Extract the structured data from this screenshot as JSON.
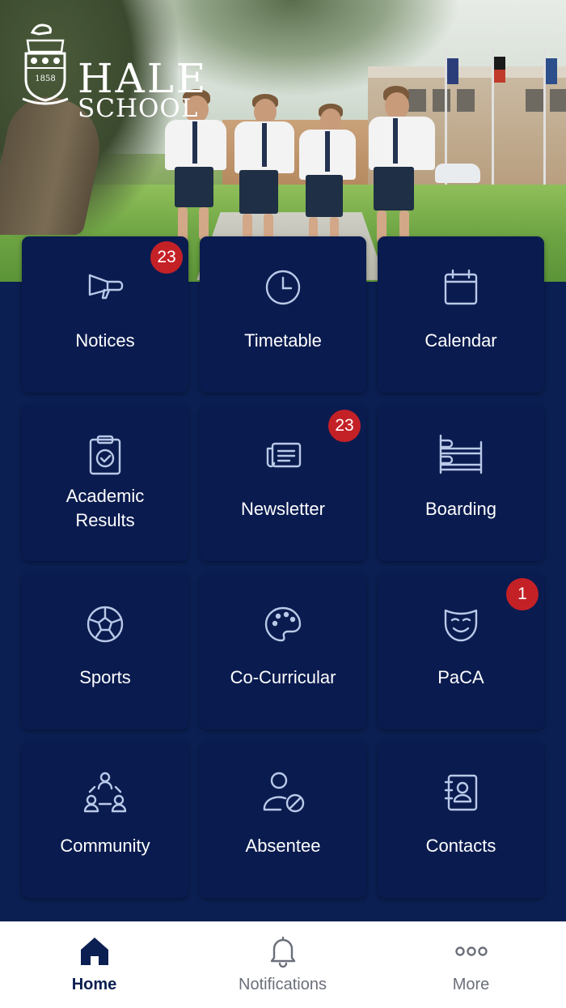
{
  "header": {
    "logo": {
      "name": "HALE",
      "subname": "SCHOOL",
      "crest_year": "1858"
    }
  },
  "tiles": [
    {
      "label": "Notices",
      "icon": "megaphone-icon",
      "badge": "23"
    },
    {
      "label": "Timetable",
      "icon": "clock-icon",
      "badge": ""
    },
    {
      "label": "Calendar",
      "icon": "calendar-icon",
      "badge": ""
    },
    {
      "label_line1": "Academic",
      "label_line2": "Results",
      "icon": "clipboard-check-icon",
      "badge": ""
    },
    {
      "label": "Newsletter",
      "icon": "newspaper-icon",
      "badge": "23"
    },
    {
      "label": "Boarding",
      "icon": "bunk-bed-icon",
      "badge": ""
    },
    {
      "label": "Sports",
      "icon": "soccer-ball-icon",
      "badge": ""
    },
    {
      "label": "Co-Curricular",
      "icon": "palette-icon",
      "badge": ""
    },
    {
      "label": "PaCA",
      "icon": "theatre-mask-icon",
      "badge": "1"
    },
    {
      "label": "Community",
      "icon": "community-icon",
      "badge": ""
    },
    {
      "label": "Absentee",
      "icon": "user-absent-icon",
      "badge": ""
    },
    {
      "label": "Contacts",
      "icon": "contacts-book-icon",
      "badge": ""
    }
  ],
  "tabbar": {
    "items": [
      {
        "label": "Home",
        "icon": "home-icon",
        "active": true
      },
      {
        "label": "Notifications",
        "icon": "bell-icon",
        "active": false
      },
      {
        "label": "More",
        "icon": "more-dots-icon",
        "active": false
      }
    ]
  },
  "colors": {
    "background": "#0b1f52",
    "tile": "#0a1b4f",
    "icon": "#b9c9e8",
    "badge": "#c42127",
    "tab_active": "#0b1f52",
    "tab_inactive": "#6b6f7a"
  }
}
